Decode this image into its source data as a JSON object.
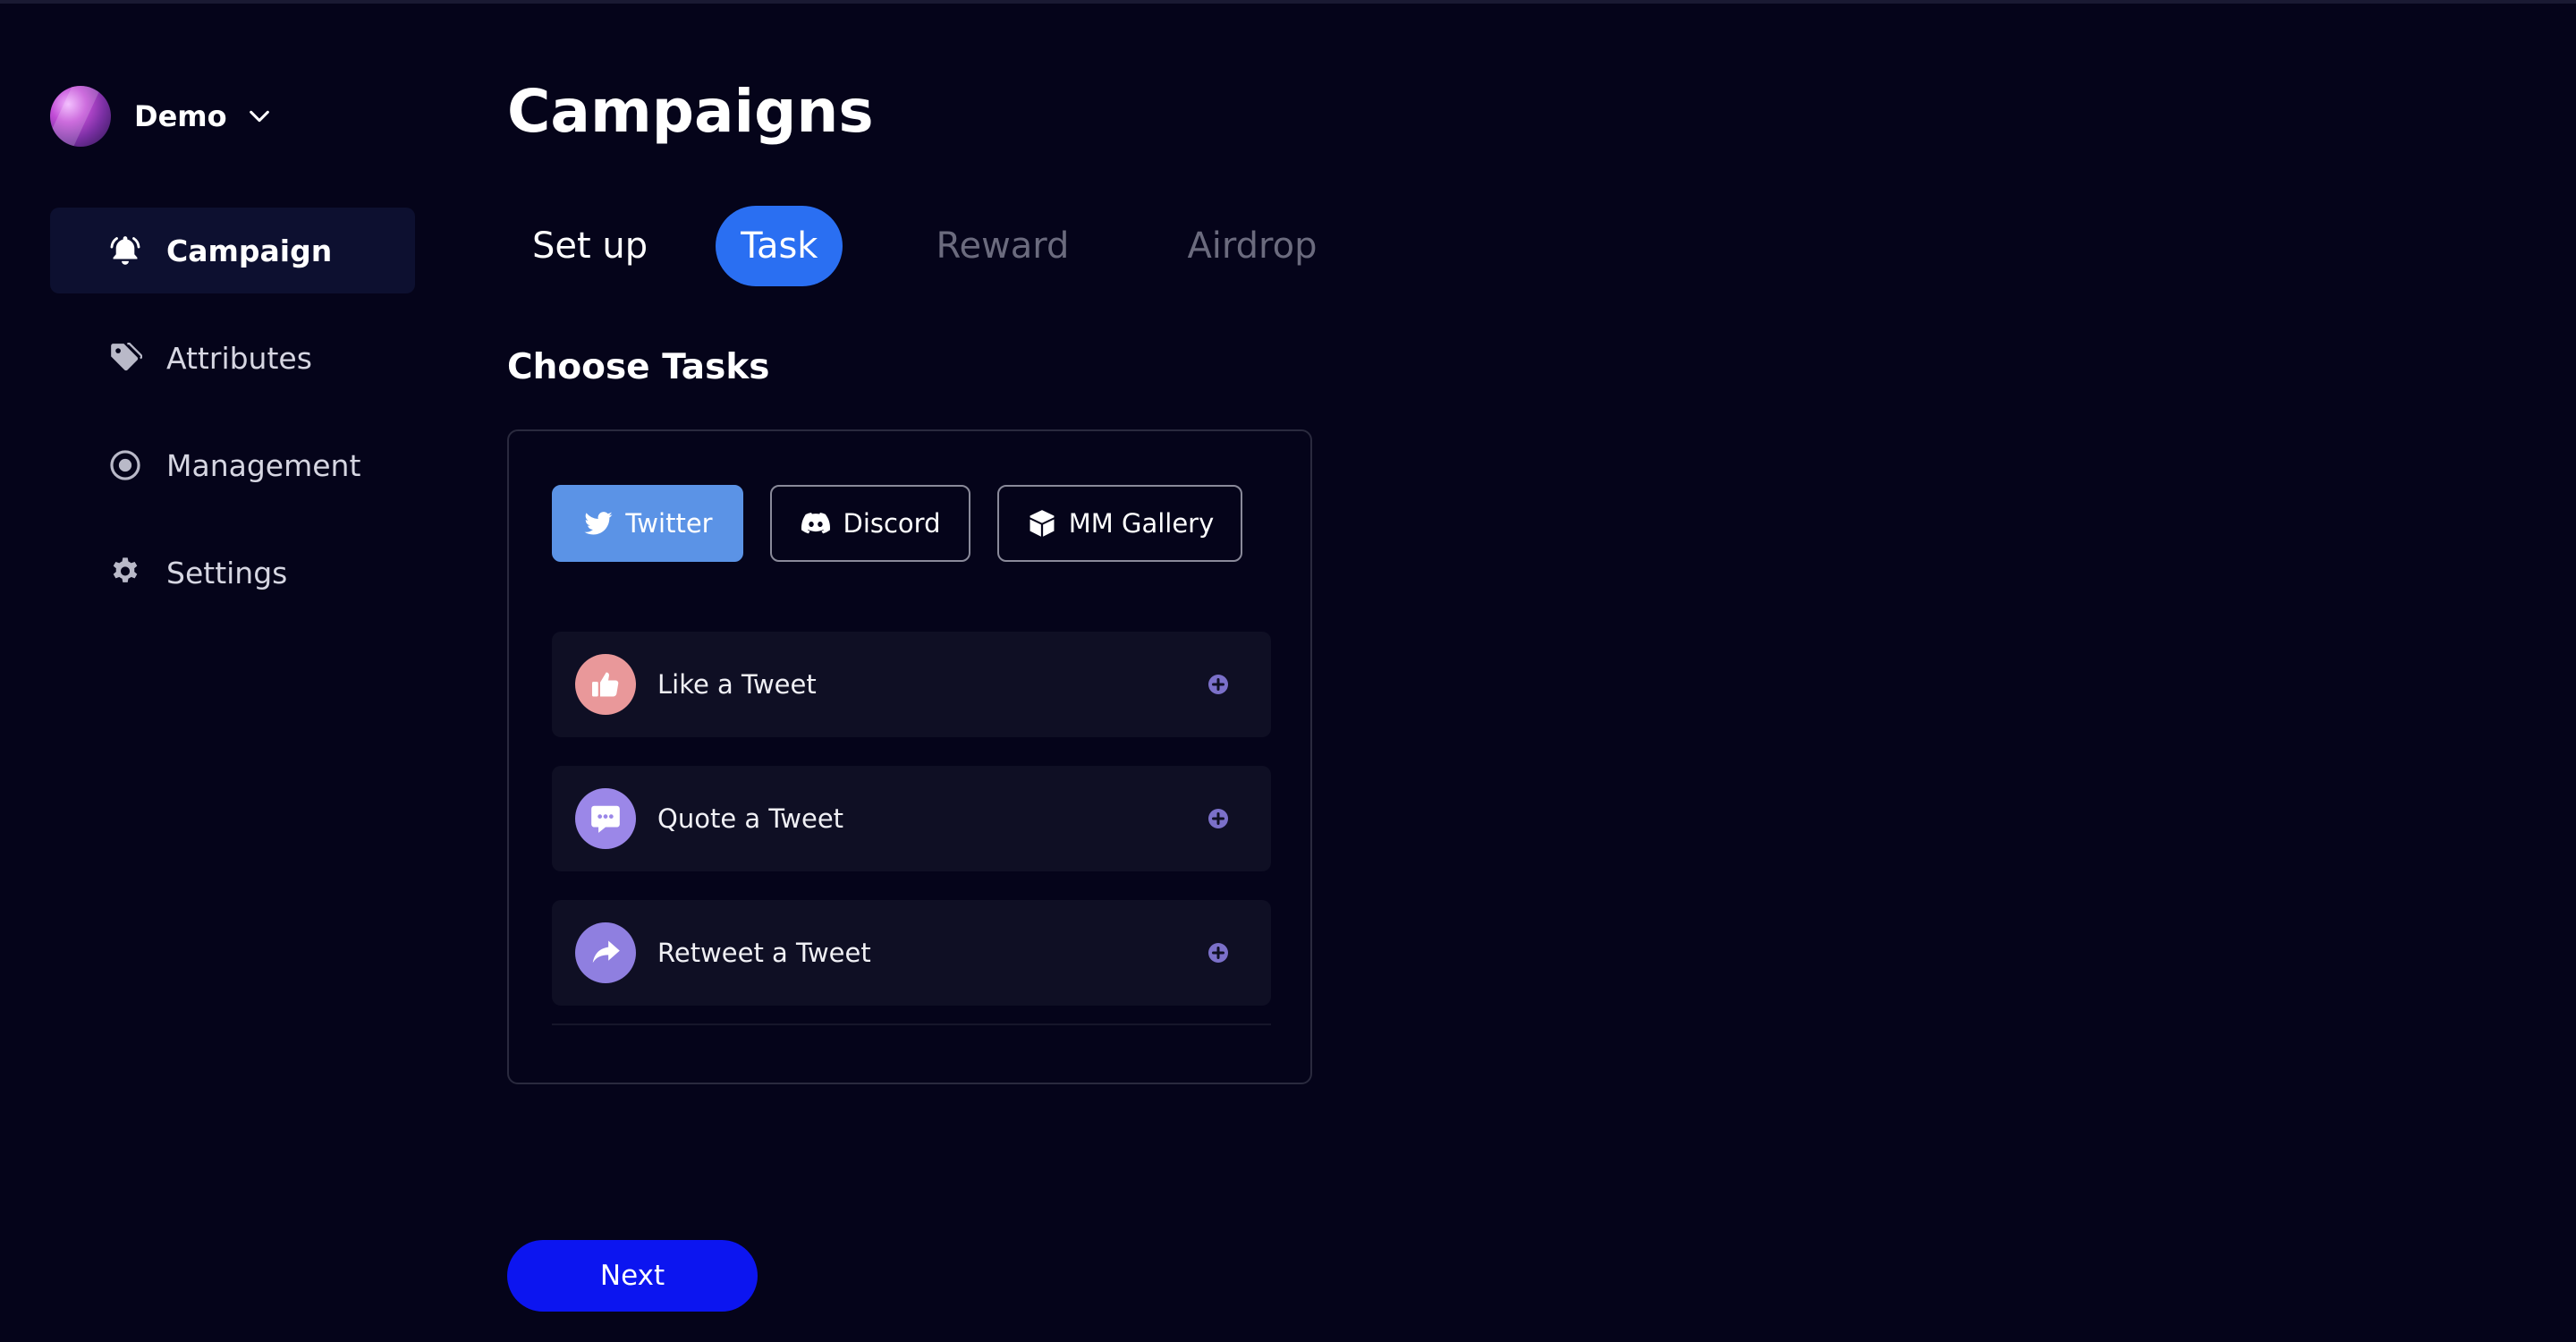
{
  "workspace": {
    "name": "Demo",
    "avatar_icon": "avatar-orb",
    "chevron_icon": "chevron-down-icon"
  },
  "sidebar": {
    "items": [
      {
        "label": "Campaign",
        "icon": "bell-icon",
        "active": true
      },
      {
        "label": "Attributes",
        "icon": "tag-icon",
        "active": false
      },
      {
        "label": "Management",
        "icon": "target-icon",
        "active": false
      },
      {
        "label": "Settings",
        "icon": "gear-icon",
        "active": false
      }
    ]
  },
  "main": {
    "title": "Campaigns",
    "steps": [
      {
        "label": "Set up",
        "state": "done"
      },
      {
        "label": "Task",
        "state": "current"
      },
      {
        "label": "Reward",
        "state": "todo"
      },
      {
        "label": "Airdrop",
        "state": "todo"
      }
    ],
    "section_title": "Choose Tasks",
    "platforms": [
      {
        "label": "Twitter",
        "icon": "twitter-icon",
        "selected": true
      },
      {
        "label": "Discord",
        "icon": "discord-icon",
        "selected": false
      },
      {
        "label": "MM Gallery",
        "icon": "cube-icon",
        "selected": false
      }
    ],
    "tasks": [
      {
        "label": "Like a Tweet",
        "icon": "thumbs-up-icon",
        "color": "#e9989a"
      },
      {
        "label": "Quote a Tweet",
        "icon": "chat-bubble-icon",
        "color": "#9b87e8"
      },
      {
        "label": "Retweet a Tweet",
        "icon": "share-arrow-icon",
        "color": "#8f7fe0"
      }
    ],
    "next_label": "Next"
  },
  "colors": {
    "background": "#05041a",
    "active_step": "#2a6ff2",
    "selected_platform": "#5b93e6",
    "primary_button": "#0c15f0",
    "task_card": "#0f0f24",
    "add_icon": "#7b70c9"
  }
}
